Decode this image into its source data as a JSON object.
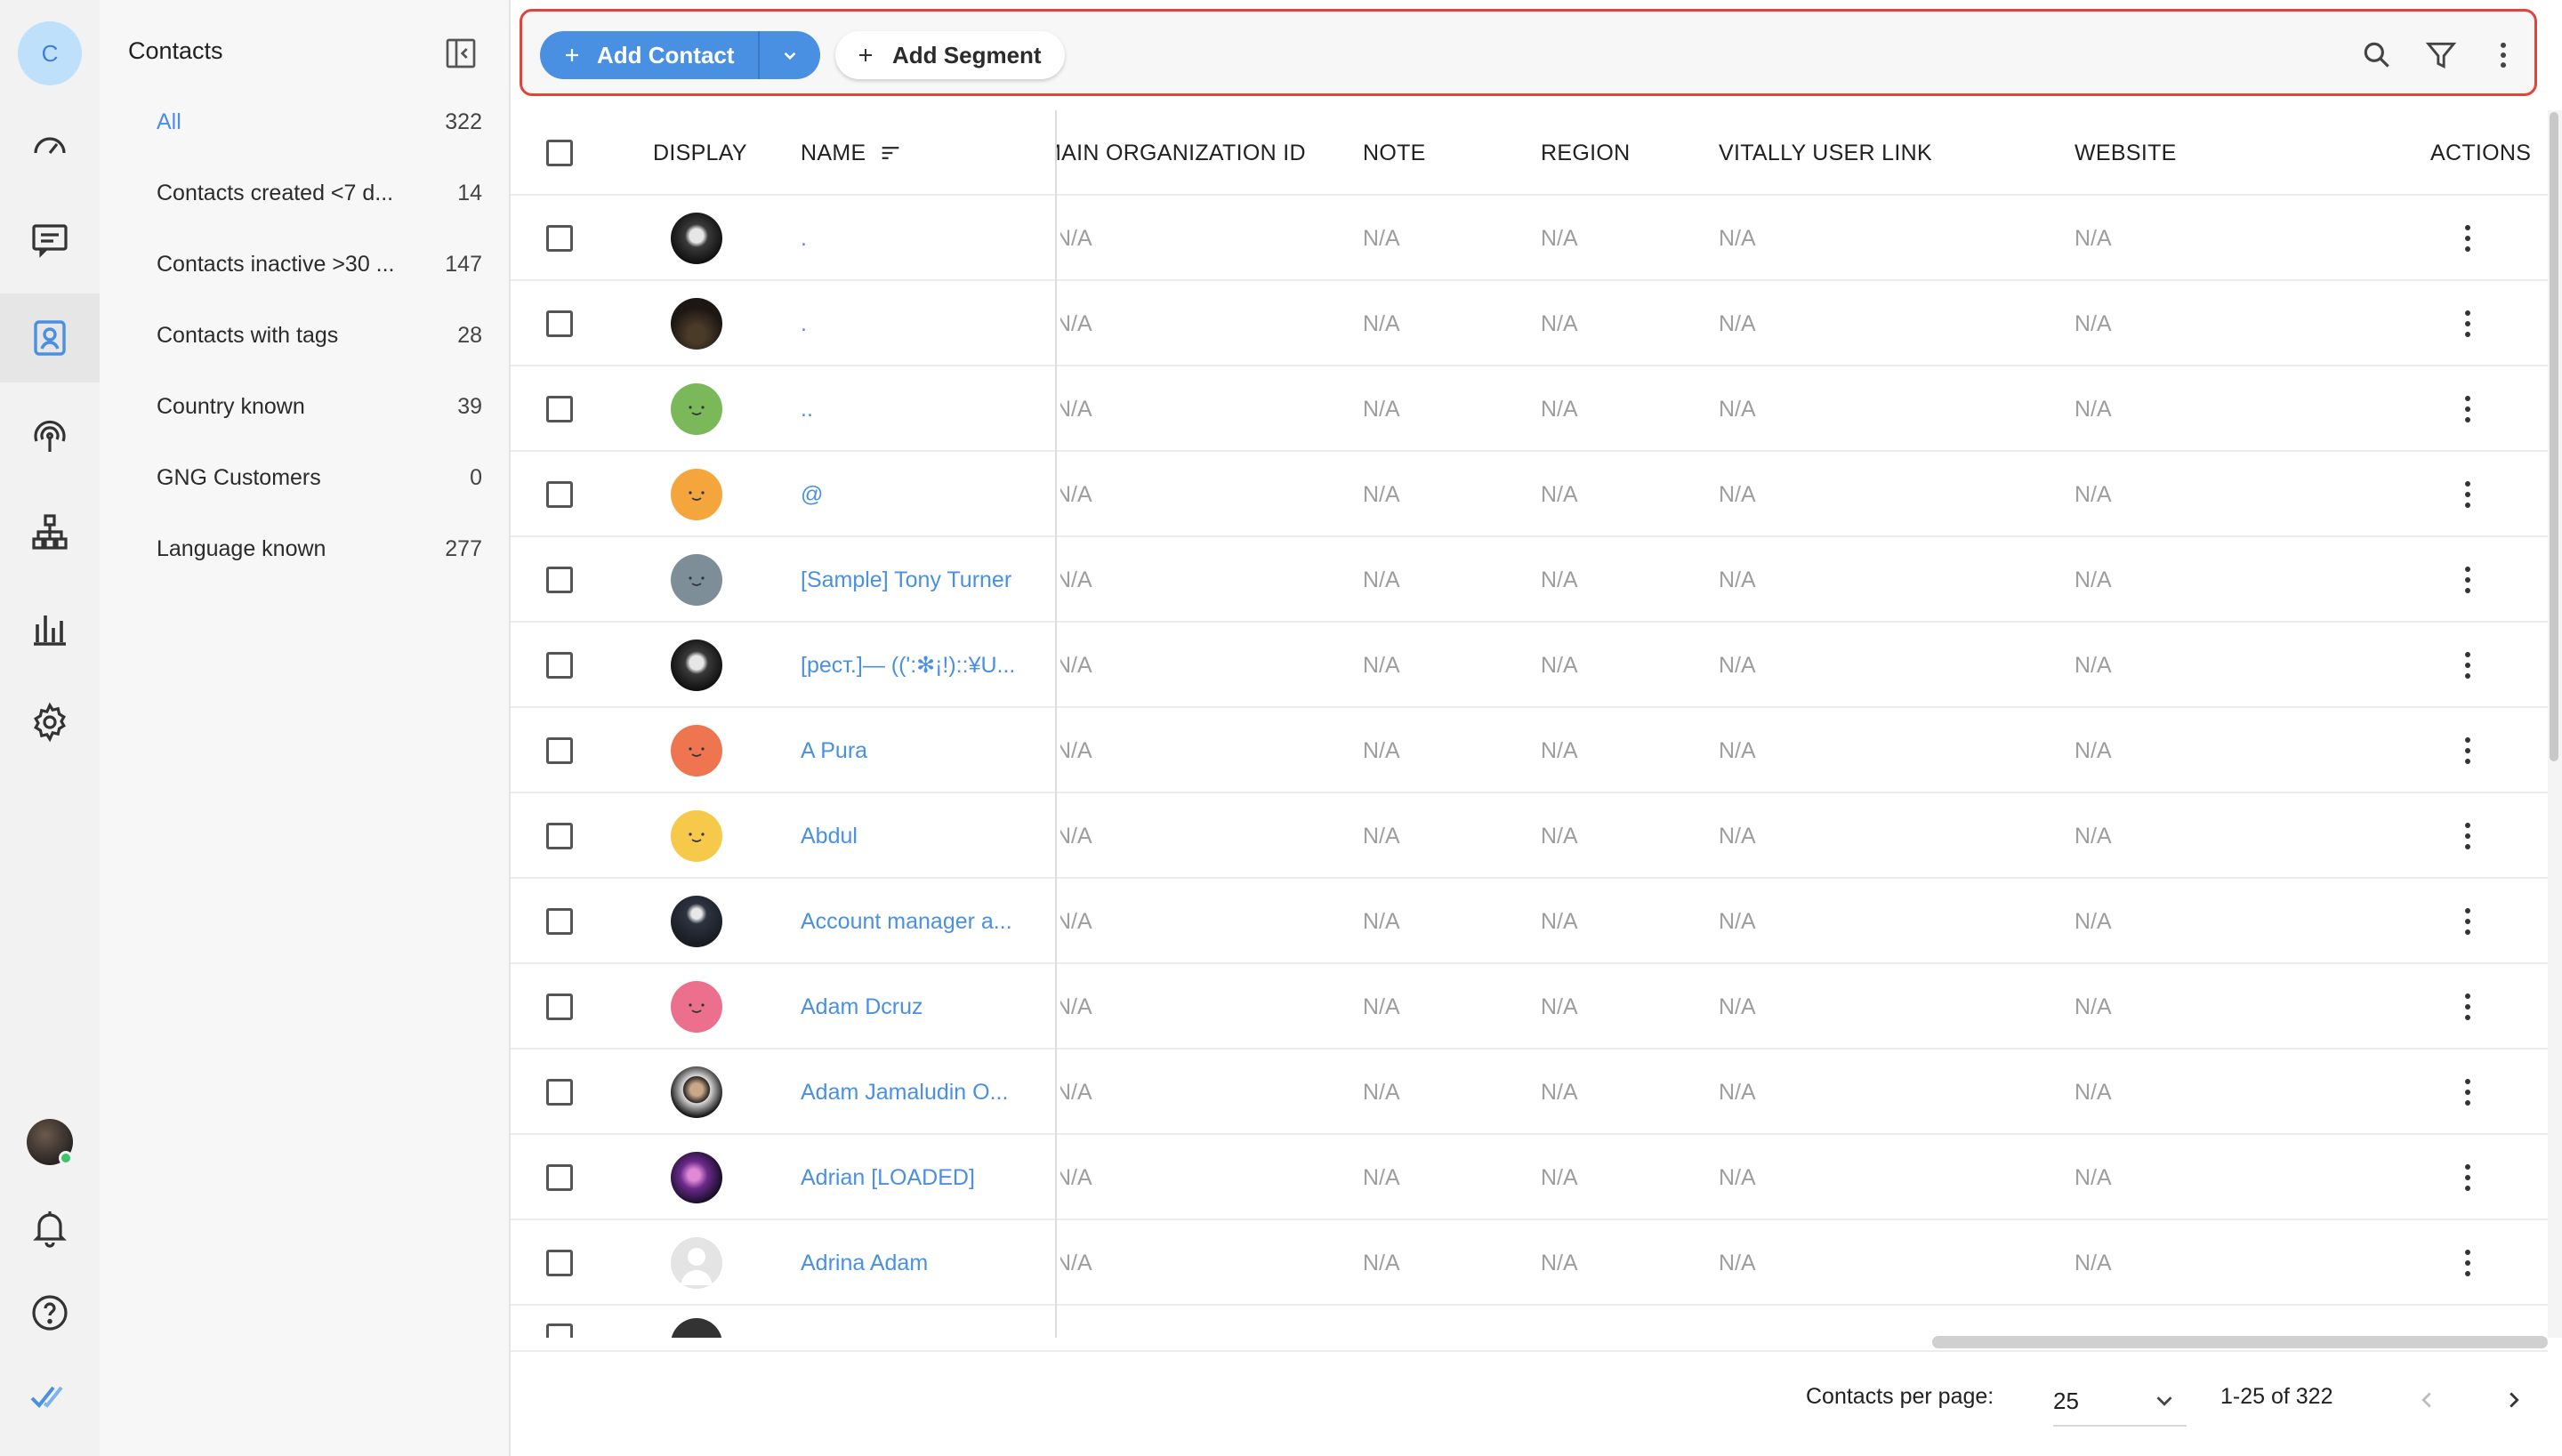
{
  "workspace": {
    "initial": "C"
  },
  "colors": {
    "accent": "#4a90e2",
    "toolbar_border": "#e2433a",
    "muted": "#9e9e9e"
  },
  "rail": {
    "icons": [
      "dashboard-icon",
      "conversations-icon",
      "contacts-icon",
      "broadcast-icon",
      "workflows-icon",
      "reports-icon",
      "settings-icon",
      "user-avatar",
      "notifications-icon",
      "help-icon",
      "brand-check-icon"
    ],
    "active": "contacts-icon"
  },
  "segments": {
    "title": "Contacts",
    "items": [
      {
        "label": "All",
        "count": "322"
      },
      {
        "label": "Contacts created <7 d...",
        "count": "14"
      },
      {
        "label": "Contacts inactive >30 ...",
        "count": "147"
      },
      {
        "label": "Contacts with tags",
        "count": "28"
      },
      {
        "label": "Country known",
        "count": "39"
      },
      {
        "label": "GNG Customers",
        "count": "0"
      },
      {
        "label": "Language known",
        "count": "277"
      }
    ]
  },
  "toolbar": {
    "add_contact_label": "Add Contact",
    "add_segment_label": "Add Segment"
  },
  "table": {
    "headers": {
      "display": "DISPLAY",
      "name": "NAME",
      "main_org": "MAIN ORGANIZATION ID",
      "note": "NOTE",
      "region": "REGION",
      "vitally": "VITALLY USER LINK",
      "website": "WEBSITE",
      "actions": "ACTIONS"
    },
    "na": "N/A",
    "rows": [
      {
        "name": ".",
        "avatar": "photo-bw"
      },
      {
        "name": ".",
        "avatar": "photo-dark"
      },
      {
        "name": "..",
        "avatar": "green-face"
      },
      {
        "name": "@",
        "avatar": "orange-face"
      },
      {
        "name": "[Sample] Tony Turner",
        "avatar": "slate-face"
      },
      {
        "name": "[pecт.]— ((':✻¡!)::¥U...",
        "avatar": "photo-bw"
      },
      {
        "name": "A Pura",
        "avatar": "red-face"
      },
      {
        "name": "Abdul",
        "avatar": "yellow-face"
      },
      {
        "name": "Account manager a...",
        "avatar": "photo-logo"
      },
      {
        "name": "Adam Dcruz",
        "avatar": "pink-face"
      },
      {
        "name": "Adam Jamaludin O...",
        "avatar": "photo-person"
      },
      {
        "name": "Adrian [LOADED]",
        "avatar": "photo-purple"
      },
      {
        "name": "Adrina Adam",
        "avatar": "default-person"
      }
    ]
  },
  "pagination": {
    "per_page_label": "Contacts per page:",
    "per_page_value": "25",
    "range": "1-25 of 322"
  }
}
